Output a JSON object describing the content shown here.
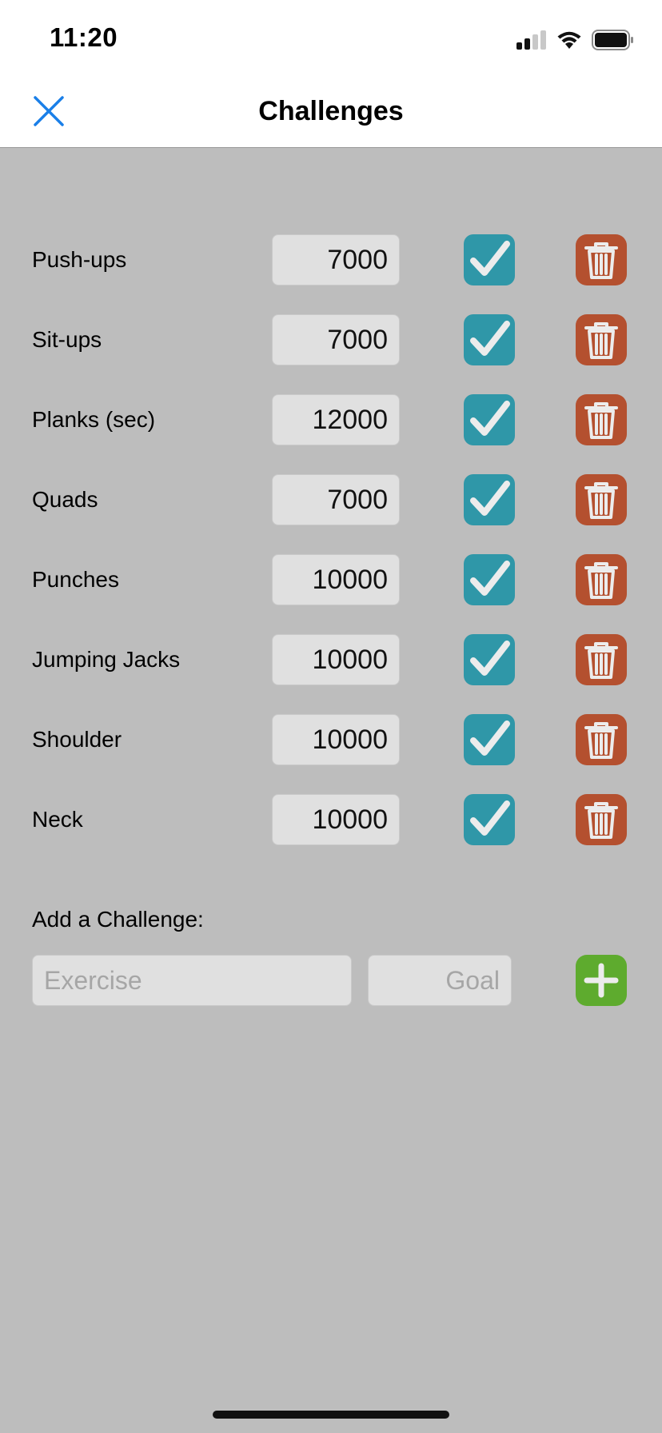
{
  "status_bar": {
    "time": "11:20"
  },
  "nav": {
    "title": "Challenges"
  },
  "challenges": [
    {
      "name": "Push-ups",
      "goal": "7000",
      "enabled": true
    },
    {
      "name": "Sit-ups",
      "goal": "7000",
      "enabled": true
    },
    {
      "name": "Planks (sec)",
      "goal": "12000",
      "enabled": true
    },
    {
      "name": "Quads",
      "goal": "7000",
      "enabled": true
    },
    {
      "name": "Punches",
      "goal": "10000",
      "enabled": true
    },
    {
      "name": "Jumping Jacks",
      "goal": "10000",
      "enabled": true
    },
    {
      "name": "Shoulder",
      "goal": "10000",
      "enabled": true
    },
    {
      "name": "Neck",
      "goal": "10000",
      "enabled": true
    }
  ],
  "add_form": {
    "label": "Add a Challenge:",
    "exercise_placeholder": "Exercise",
    "goal_placeholder": "Goal"
  },
  "icons": {
    "close": "close-icon",
    "check": "checkmark-icon",
    "delete": "trash-icon",
    "add": "plus-icon"
  },
  "colors": {
    "background": "#bdbdbd",
    "accent_blue": "#1a7fe8",
    "check": "#2f97a8",
    "delete": "#b4502f",
    "add": "#5eab2e"
  }
}
